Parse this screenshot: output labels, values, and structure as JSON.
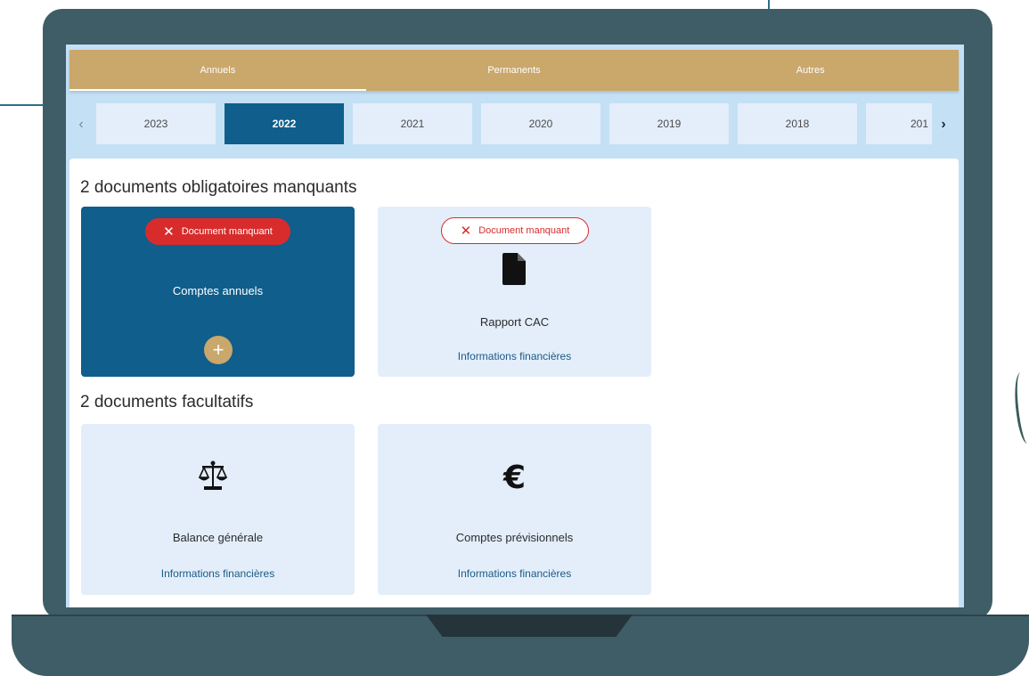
{
  "tabs": [
    {
      "label": "Annuels",
      "active": true
    },
    {
      "label": "Permanents",
      "active": false
    },
    {
      "label": "Autres",
      "active": false
    }
  ],
  "years": [
    "2023",
    "2022",
    "2021",
    "2020",
    "2019",
    "2018",
    "201"
  ],
  "selected_year": "2022",
  "year_nav": {
    "prev_icon": "chevron-left-icon",
    "next_icon": "chevron-right-icon"
  },
  "mandatory": {
    "heading": "2 documents obligatoires manquants",
    "cards": [
      {
        "badge": "Document manquant",
        "label": "Comptes annuels",
        "action_icon": "plus-icon"
      },
      {
        "badge": "Document manquant",
        "label": "Rapport CAC",
        "category": "Informations financières",
        "icon": "file-icon"
      }
    ]
  },
  "optional": {
    "heading": "2 documents facultatifs",
    "cards": [
      {
        "label": "Balance générale",
        "category": "Informations financières",
        "icon": "scale-icon"
      },
      {
        "label": "Comptes prévisionnels",
        "category": "Informations financières",
        "icon": "euro-icon"
      }
    ]
  },
  "colors": {
    "tab_bar": "#caa76b",
    "active_year": "#0f5e8c",
    "card_bg": "#e3eefa",
    "missing_badge": "#d82c2c",
    "laptop": "#3e5d66"
  }
}
